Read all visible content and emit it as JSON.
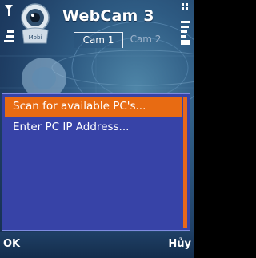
{
  "app": {
    "title": "WebCam 3"
  },
  "tabs": [
    {
      "label": "Cam 1",
      "active": true
    },
    {
      "label": "Cam 2",
      "active": false
    }
  ],
  "menu": {
    "items": [
      {
        "label": "Scan for available PC's...",
        "selected": true
      },
      {
        "label": "Enter PC IP Address...",
        "selected": false
      }
    ]
  },
  "softkeys": {
    "left": "OK",
    "right": "Hủy"
  },
  "colors": {
    "menu_background": "#3743a7",
    "selection": "#e86b12",
    "scrollbar": "#e8681a",
    "header_text": "#ffffff"
  },
  "icons": [
    "signal-strength-icon",
    "battery-icon",
    "webcam-mascot-icon"
  ]
}
